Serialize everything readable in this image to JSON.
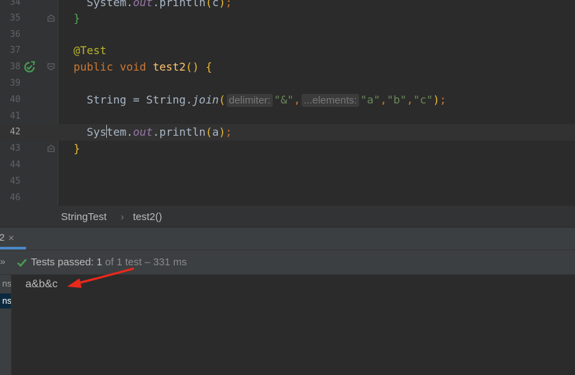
{
  "editor": {
    "lines": [
      {
        "num": "34",
        "code": "System.out.println(c);"
      },
      {
        "num": "35",
        "code": "}"
      },
      {
        "num": "36",
        "code": ""
      },
      {
        "num": "37",
        "code": "@Test"
      },
      {
        "num": "38",
        "code": "public void test2() {"
      },
      {
        "num": "39",
        "code": ""
      },
      {
        "num": "40",
        "code": "String a = String.join( delimiter: \"&\", ...elements: \"a\",\"b\",\"c\");"
      },
      {
        "num": "41",
        "code": ""
      },
      {
        "num": "42",
        "code": "System.out.println(a);"
      },
      {
        "num": "43",
        "code": "}"
      },
      {
        "num": "44",
        "code": ""
      },
      {
        "num": "45",
        "code": ""
      },
      {
        "num": "46",
        "code": ""
      }
    ],
    "tokens": {
      "system": "System",
      "sys_a": "Sys",
      "sys_b": "tem",
      "dot": ".",
      "out": "out",
      "println": "println",
      "lparen": "(",
      "rparen": ")",
      "semi": ";",
      "var_c": "c",
      "var_a": "a",
      "rbrace": "}",
      "lbrace": "{",
      "annotation": "@Test",
      "kw_public": "public",
      "kw_void": "void",
      "method": "test2",
      "type_string": "String",
      "assign": " = ",
      "join": "join",
      "hint_delimiter": "delimiter:",
      "str_amp": "\"&\"",
      "comma": ",",
      "hint_elements": "...elements:",
      "str_a": "\"a\"",
      "str_b": "\"b\"",
      "str_c": "\"c\""
    }
  },
  "breadcrumb": {
    "class_name": "StringTest",
    "separator": "›",
    "method_name": "test2()"
  },
  "run_panel": {
    "tab_fragment": "2",
    "tab_close": "×",
    "collapse_glyph": "»",
    "status_prefix": "Tests passed: ",
    "status_count": "1",
    "status_suffix": " of 1 test – 331 ms",
    "tree_items": [
      "ns",
      "ns"
    ],
    "console_output": "a&b&c"
  },
  "colors": {
    "accent": "#4a88c7",
    "pass_green": "#499c54",
    "annotation_arrow": "#e8291c"
  }
}
